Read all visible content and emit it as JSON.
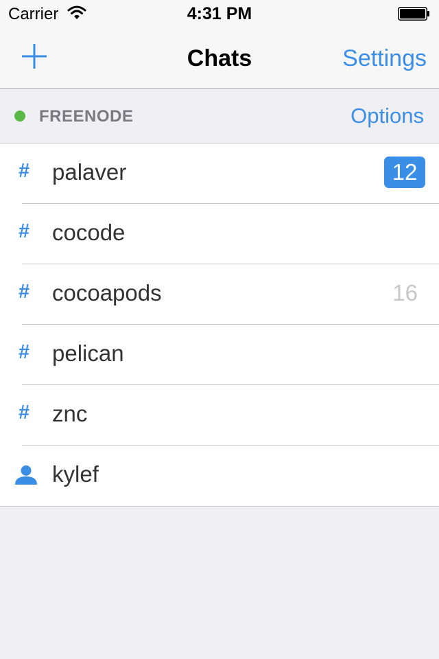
{
  "status_bar": {
    "carrier": "Carrier",
    "time": "4:31 PM"
  },
  "nav": {
    "title": "Chats",
    "settings_label": "Settings",
    "add_icon": "plus-icon"
  },
  "network": {
    "name": "FREENODE",
    "options_label": "Options",
    "status_color": "#5ab947"
  },
  "chats": [
    {
      "type": "channel",
      "icon": "hash-icon",
      "prefix": "#",
      "name": "palaver",
      "unread": "12"
    },
    {
      "type": "channel",
      "icon": "hash-icon",
      "prefix": "#",
      "name": "cocode"
    },
    {
      "type": "channel",
      "icon": "hash-icon",
      "prefix": "#",
      "name": "cocoapods",
      "count": "16"
    },
    {
      "type": "channel",
      "icon": "hash-icon",
      "prefix": "#",
      "name": "pelican"
    },
    {
      "type": "channel",
      "icon": "hash-icon",
      "prefix": "#",
      "name": "znc"
    },
    {
      "type": "query",
      "icon": "person-icon",
      "name": "kylef"
    }
  ],
  "colors": {
    "accent": "#3a8ee6",
    "background": "#efeff4",
    "online": "#5ab947"
  }
}
